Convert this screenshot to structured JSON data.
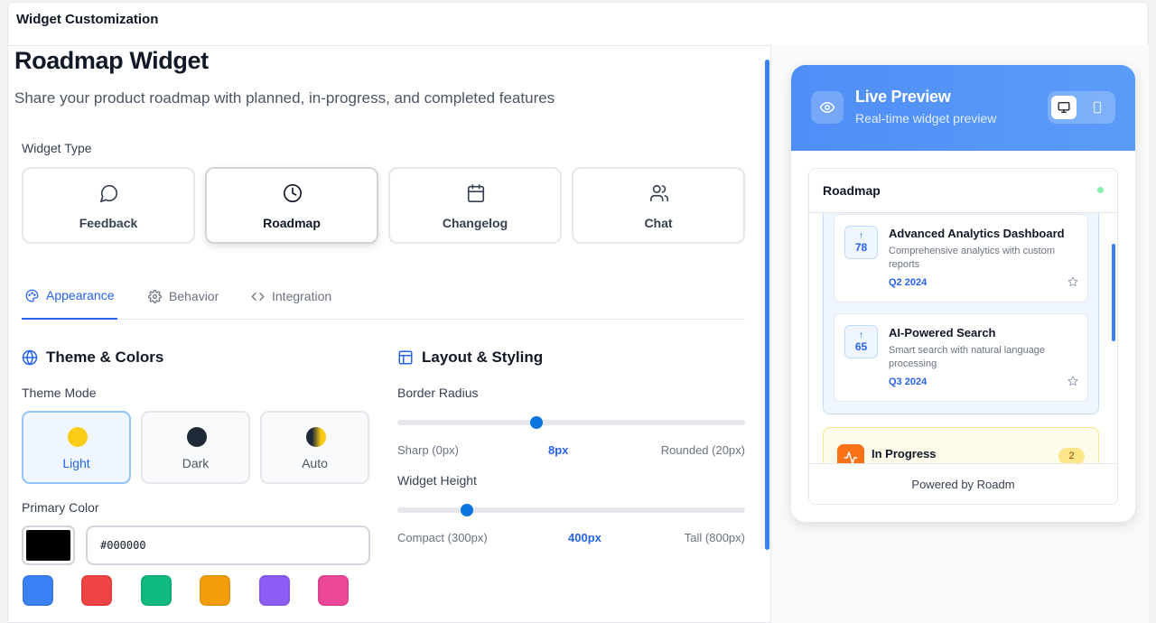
{
  "window": {
    "title": "Widget Customization"
  },
  "page": {
    "title": "Roadmap Widget",
    "subtitle": "Share your product roadmap with planned, in-progress, and completed features"
  },
  "widget_type": {
    "label": "Widget Type",
    "options": [
      {
        "label": "Feedback",
        "icon": "message-circle-icon",
        "selected": false
      },
      {
        "label": "Roadmap",
        "icon": "clock-icon",
        "selected": true
      },
      {
        "label": "Changelog",
        "icon": "calendar-icon",
        "selected": false
      },
      {
        "label": "Chat",
        "icon": "users-icon",
        "selected": false
      }
    ]
  },
  "tabs": [
    {
      "label": "Appearance",
      "icon": "palette-icon",
      "active": true
    },
    {
      "label": "Behavior",
      "icon": "gear-icon",
      "active": false
    },
    {
      "label": "Integration",
      "icon": "code-icon",
      "active": false
    }
  ],
  "theme": {
    "section_title": "Theme & Colors",
    "mode_label": "Theme Mode",
    "modes": [
      {
        "label": "Light",
        "color": "#facc15",
        "selected": true
      },
      {
        "label": "Dark",
        "color": "#1f2937",
        "selected": false
      },
      {
        "label": "Auto",
        "color": "gradient",
        "selected": false
      }
    ],
    "primary_label": "Primary Color",
    "primary_value": "#000000",
    "presets": [
      "#3b82f6",
      "#ef4444",
      "#10b981",
      "#f59e0b",
      "#8b5cf6",
      "#ec4899"
    ]
  },
  "layout": {
    "section_title": "Layout & Styling",
    "border_radius": {
      "label": "Border Radius",
      "min_label": "Sharp (0px)",
      "value_label": "8px",
      "max_label": "Rounded (20px)",
      "value": 8,
      "min": 0,
      "max": 20
    },
    "widget_height": {
      "label": "Widget Height",
      "min_label": "Compact (300px)",
      "value_label": "400px",
      "max_label": "Tall (800px)",
      "value": 400,
      "min": 300,
      "max": 800
    }
  },
  "preview": {
    "title": "Live Preview",
    "subtitle": "Real-time widget preview",
    "device": "desktop",
    "widget": {
      "title": "Roadmap",
      "items": [
        {
          "votes": "78",
          "title": "Advanced Analytics Dashboard",
          "description": "Comprehensive analytics with custom reports",
          "quarter": "Q2 2024"
        },
        {
          "votes": "65",
          "title": "AI-Powered Search",
          "description": "Smart search with natural language processing",
          "quarter": "Q3 2024"
        }
      ],
      "in_progress": {
        "label": "In Progress",
        "count": "2"
      },
      "footer": "Powered by Roadm"
    }
  },
  "colors": {
    "accent": "#2563eb",
    "slider": "#0c74e0",
    "preview_header": "#4f8ef7"
  }
}
